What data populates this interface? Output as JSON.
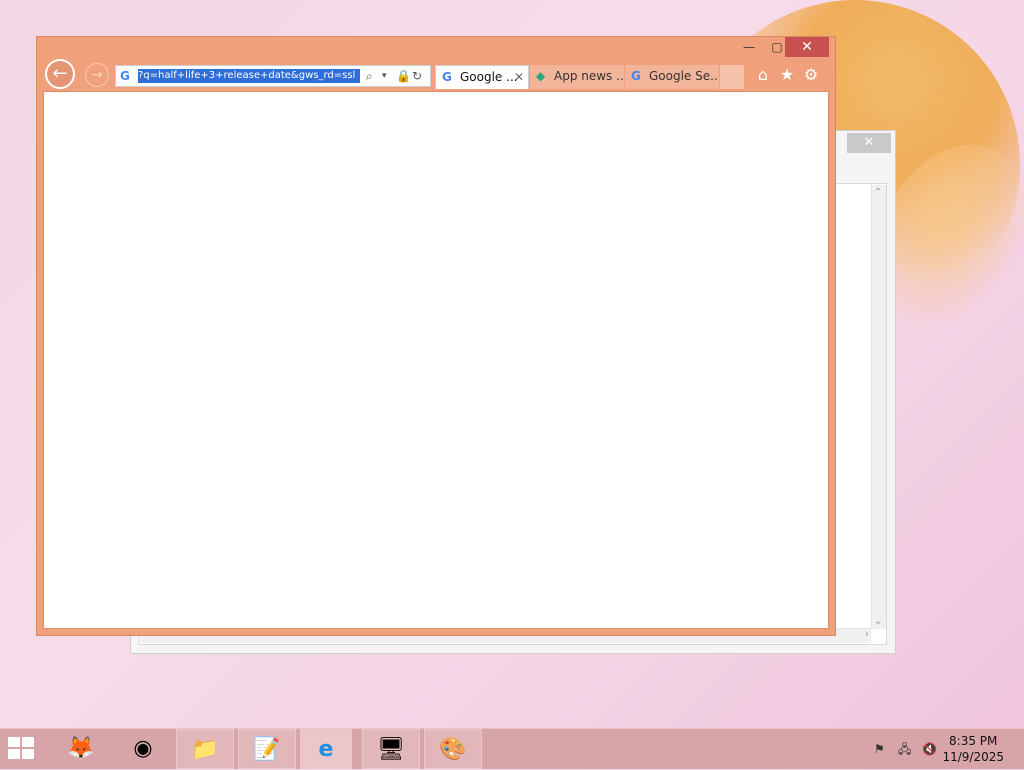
{
  "browser": {
    "url": "?q=half+life+3+release+date&gws_rd=ssl",
    "tabs": [
      {
        "label": "Google ...",
        "favicon": "G"
      },
      {
        "label": "App news ...",
        "favicon": "app-news-icon"
      },
      {
        "label": "Google Se...",
        "favicon": "G"
      }
    ],
    "caption": {
      "minimize": "—",
      "maximize": "▢",
      "close": "✕"
    },
    "nav": {
      "back": "←",
      "forward": "→"
    }
  },
  "background_window": {
    "close": "✕"
  },
  "taskbar": {
    "clock_time": "8:35 PM",
    "clock_date": "11/9/2025",
    "pinned": [
      "firefox-icon",
      "chrome-icon",
      "file-explorer-icon",
      "notepad-icon",
      "internet-explorer-icon",
      "control-panel-icon",
      "paint-icon"
    ]
  },
  "colors": {
    "window_frame": "#f0a07a",
    "taskbar": "#d7a4a7",
    "url_highlight": "#2f6dd8",
    "close_red": "#c75050"
  }
}
